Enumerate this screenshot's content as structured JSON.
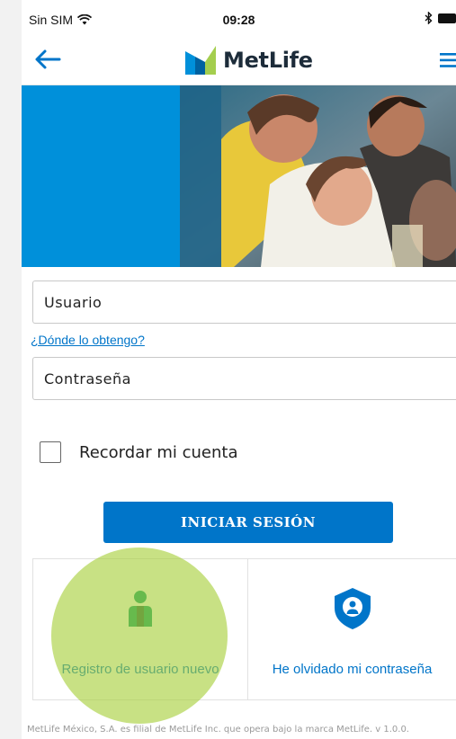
{
  "status_bar": {
    "carrier": "Sin SIM",
    "time": "09:28",
    "wifi_icon": "wifi-icon",
    "bluetooth_icon": "bluetooth-icon",
    "battery_icon": "battery-icon"
  },
  "header": {
    "brand": "MetLife",
    "back_icon": "arrow-left-icon",
    "menu_icon": "hamburger-menu-icon"
  },
  "login": {
    "username_placeholder": "Usuario",
    "help_link": "¿Dónde lo obtengo?",
    "password_placeholder": "Contraseña",
    "remember_label": "Recordar mi cuenta",
    "remember_checked": false,
    "submit_label": "INICIAR SESIÓN"
  },
  "actions": [
    {
      "label": "Registro de usuario nuevo",
      "icon": "new-user-icon"
    },
    {
      "label": "He olvidado mi contraseña",
      "icon": "shield-user-icon"
    }
  ],
  "footer": {
    "text": "MetLife México, S.A. es filial de MetLife Inc. que opera bajo la marca MetLife. v 1.0.0."
  },
  "colors": {
    "primary": "#0075c9",
    "hero_blue": "#0090da",
    "logo_green": "#a4ce4e",
    "icon_green": "#009a6e",
    "highlight": "#a6ce39"
  }
}
